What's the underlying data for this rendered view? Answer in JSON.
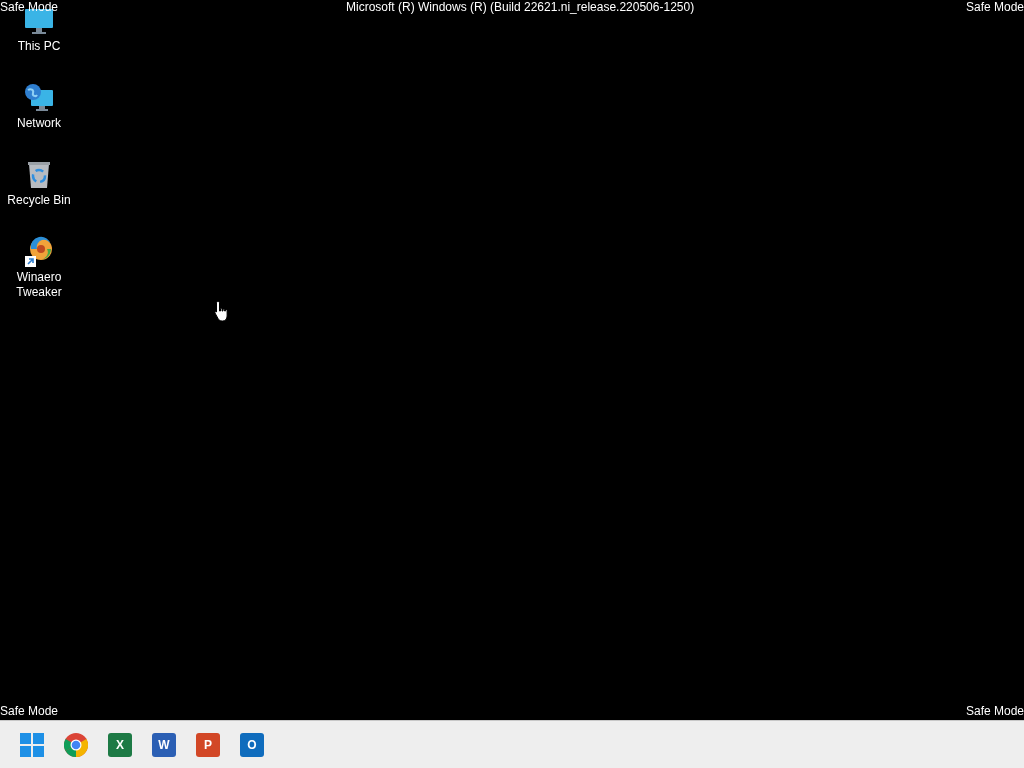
{
  "watermarks": {
    "top_left": "Safe Mode",
    "top_center": "Microsoft (R) Windows (R) (Build 22621.ni_release.220506-1250)",
    "top_right": "Safe Mode",
    "bottom_left": "Safe Mode",
    "bottom_right": "Safe Mode"
  },
  "desktop_icons": [
    {
      "kind": "pc",
      "label": "This PC"
    },
    {
      "kind": "network",
      "label": "Network"
    },
    {
      "kind": "recycle",
      "label": "Recycle Bin"
    },
    {
      "kind": "shortcut",
      "label": "Winaero Tweaker"
    }
  ],
  "taskbar": [
    {
      "kind": "start"
    },
    {
      "kind": "chrome"
    },
    {
      "kind": "office",
      "glyph": "X",
      "color": "#1d7a45"
    },
    {
      "kind": "office",
      "glyph": "W",
      "color": "#2b5fb4"
    },
    {
      "kind": "office",
      "glyph": "P",
      "color": "#d24726"
    },
    {
      "kind": "office",
      "glyph": "O",
      "color": "#0f6cbd"
    }
  ]
}
